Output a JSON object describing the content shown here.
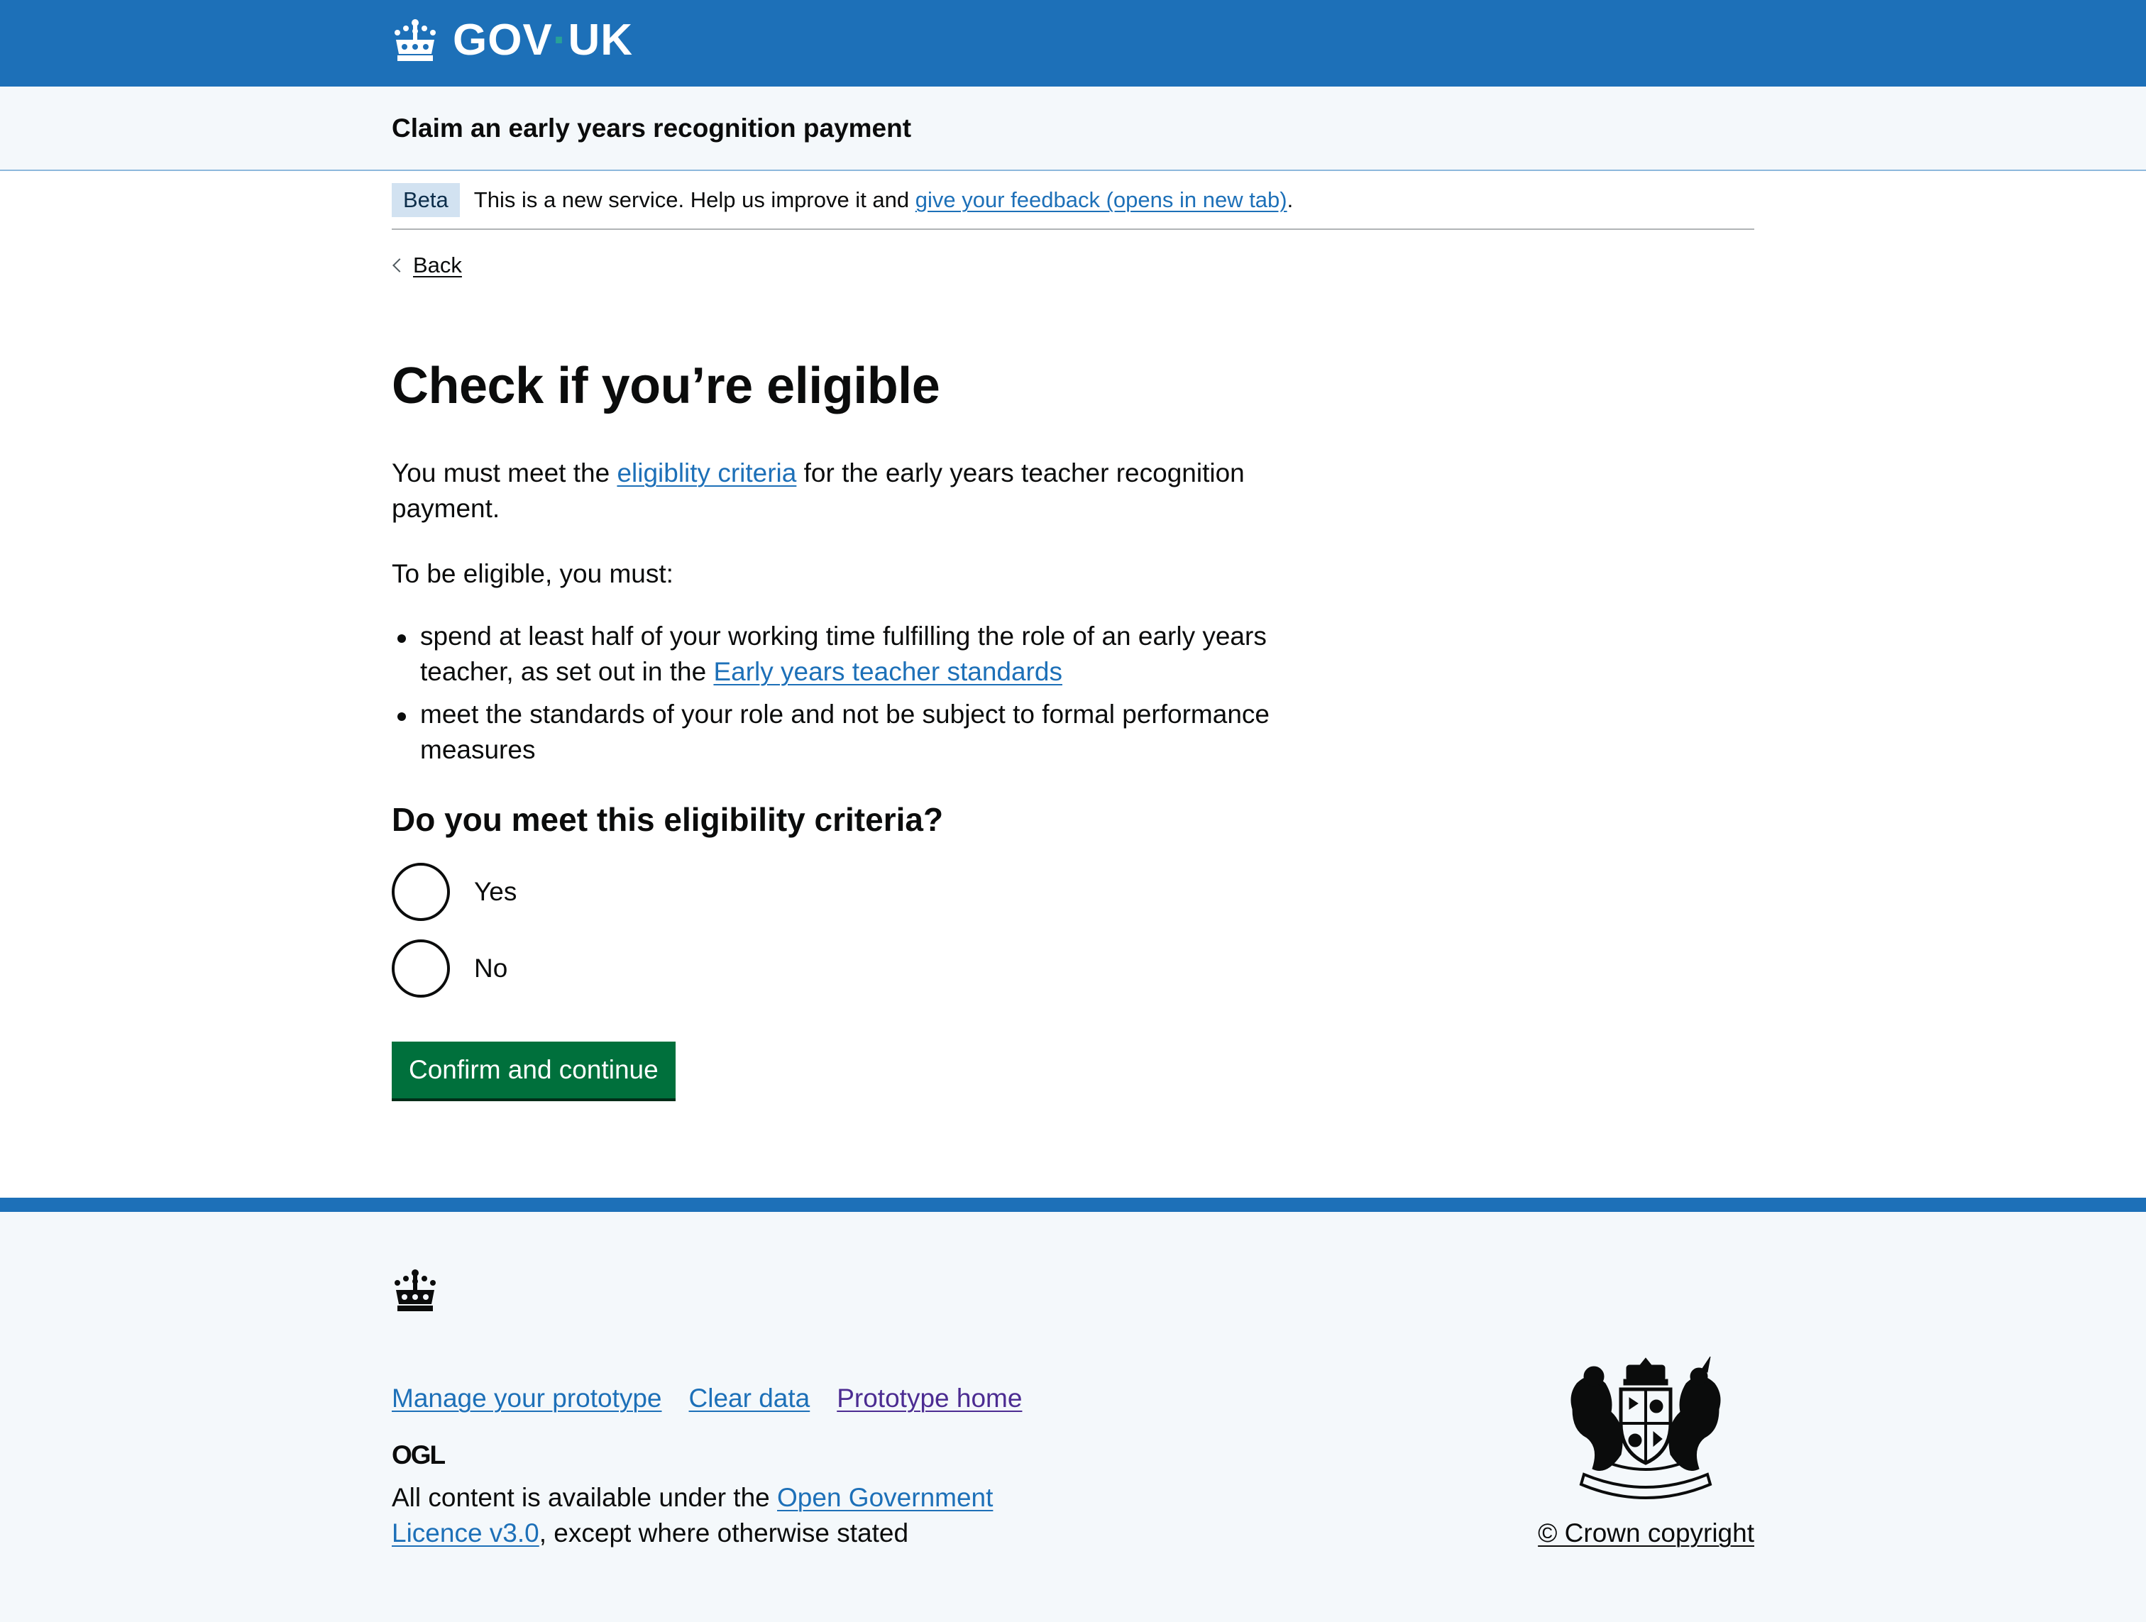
{
  "header": {
    "logo_text_a": "GOV",
    "logo_dot": "·",
    "logo_text_b": "UK",
    "logo_icon": "crown-icon",
    "brand_color": "#1d70b8",
    "service_name": "Claim an early years recognition payment"
  },
  "phase_banner": {
    "tag": "Beta",
    "text_before": "This is a new service. Help us improve it and ",
    "link": "give your feedback (opens in new tab)",
    "text_after": "."
  },
  "back_link": "Back",
  "main": {
    "title": "Check if you’re eligible",
    "intro_before": "You must meet the ",
    "intro_link": "eligiblity criteria",
    "intro_after": " for the early years teacher recognition payment.",
    "lead": "To be eligible, you must:",
    "bullets": {
      "b1_before": "spend at least half of your working time fulfilling the role of an early years teacher, as set out in the ",
      "b1_link": "Early years teacher standards",
      "b2": "meet the standards of your role and not be subject to formal performance measures"
    },
    "question": "Do you meet this eligibility criteria?",
    "options": {
      "yes": "Yes",
      "no": "No"
    },
    "button": "Confirm and continue",
    "button_color": "#00703c"
  },
  "footer": {
    "links": {
      "manage": "Manage your prototype",
      "clear": "Clear data",
      "home": "Prototype home"
    },
    "ogl_label": "OGL",
    "licence_before": "All content is available under the ",
    "licence_link": "Open Government Licence v3.0",
    "licence_after": ", except where otherwise stated",
    "crest_icon": "royal-coat-of-arms-icon",
    "copyright": "© Crown copyright"
  }
}
